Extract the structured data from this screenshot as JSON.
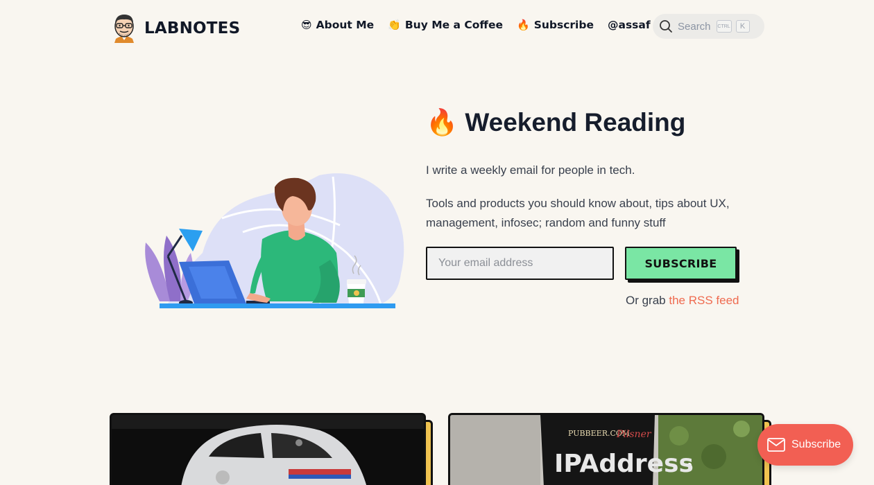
{
  "site": {
    "name": "LABNOTES",
    "logo_icon": "cartoon-avatar-icon"
  },
  "nav": {
    "items": [
      {
        "emoji": "😎",
        "label": "About Me"
      },
      {
        "emoji": "👏",
        "label": "Buy Me a Coffee"
      },
      {
        "emoji": "🔥",
        "label": "Subscribe"
      },
      {
        "emoji": "",
        "label": "@assaf"
      }
    ]
  },
  "search": {
    "label": "Search",
    "shortcut_mod": "CTRL",
    "shortcut_key": "K"
  },
  "hero": {
    "title_emoji": "🔥",
    "title": "Weekend Reading",
    "line1": "I write a weekly email for people in tech.",
    "line2": "Tools and products you should know about, tips about UX, management, infosec; random and funny stuff",
    "email_placeholder": "Your email address",
    "email_value": "",
    "subscribe_label": "SUBSCRIBE",
    "rss_prefix": "Or grab",
    "rss_link": "the RSS feed"
  },
  "floating_subscribe": {
    "label": "Subscribe",
    "icon": "envelope-icon"
  },
  "colors": {
    "background": "#f9f6f0",
    "button_green": "#7ae6a4",
    "link_orange": "#ef6a4f",
    "float_button": "#f25f53",
    "card_accent": "#f0c350"
  }
}
